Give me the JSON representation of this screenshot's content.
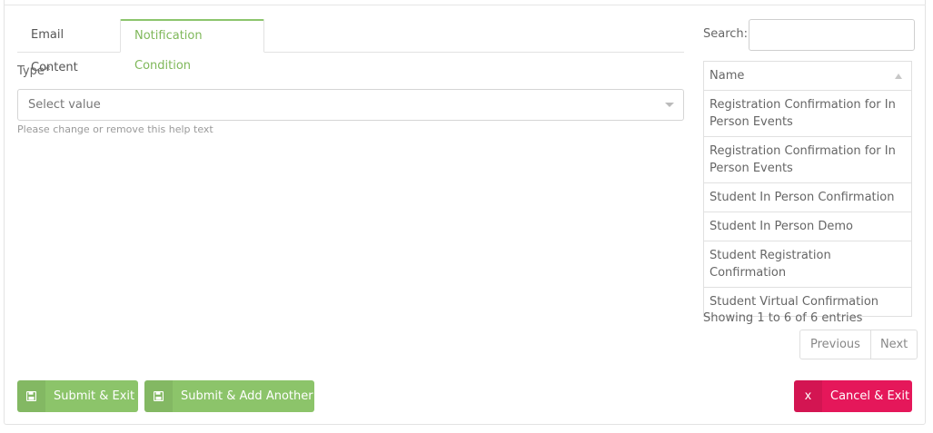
{
  "tabs": [
    {
      "label": "Email Content",
      "active": false
    },
    {
      "label": "Notification Condition",
      "active": true
    }
  ],
  "type_field": {
    "label": "Type*",
    "placeholder": "Select value",
    "help_text": "Please change or remove this help text"
  },
  "search": {
    "label": "Search:",
    "value": ""
  },
  "table": {
    "header": "Name",
    "sort_icon": "sort-ascending-icon",
    "rows": [
      "Registration Confirmation for In Person Events",
      "Registration Confirmation for In Person Events",
      "Student In Person Confirmation",
      "Student In Person Demo",
      "Student Registration Confirmation",
      "Student Virtual Confirmation"
    ]
  },
  "pagination": {
    "info": "Showing 1 to 6 of 6 entries",
    "previous": "Previous",
    "next": "Next"
  },
  "buttons": {
    "submit_exit": "Submit & Exit",
    "submit_add": "Submit & Add Another",
    "cancel_exit": "Cancel & Exit",
    "save_icon": "floppy-disk-icon",
    "cancel_icon": "x",
    "primary_color": "#8cc46a",
    "danger_color": "#e5175a"
  }
}
